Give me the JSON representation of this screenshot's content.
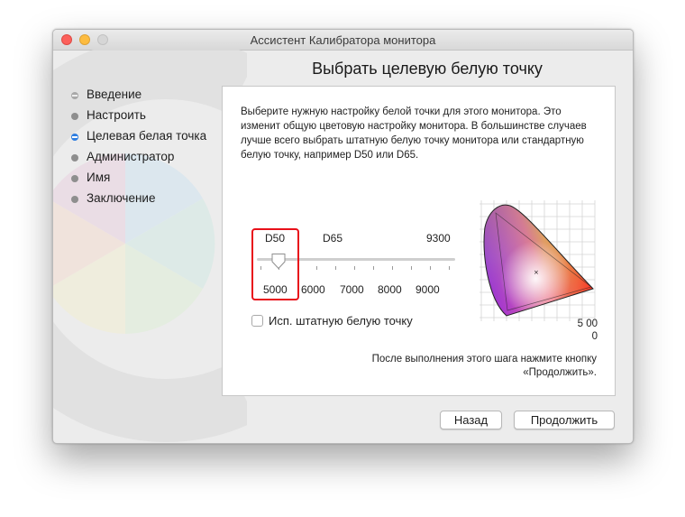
{
  "window": {
    "title": "Ассистент Калибратора монитора"
  },
  "page": {
    "title": "Выбрать целевую белую точку"
  },
  "steps": [
    {
      "label": "Введение",
      "state": "done"
    },
    {
      "label": "Настроить",
      "state": "pending"
    },
    {
      "label": "Целевая белая точка",
      "state": "active"
    },
    {
      "label": "Администратор",
      "state": "pending"
    },
    {
      "label": "Имя",
      "state": "pending"
    },
    {
      "label": "Заключение",
      "state": "pending"
    }
  ],
  "description": "Выберите нужную настройку белой точки для этого монитора. Это изменит общую цветовую настройку монитора. В большинстве случаев лучше всего выбрать штатную белую точку монитора или стандартную белую точку, например D50 или D65.",
  "slider": {
    "top_labels": [
      "D50",
      "D65",
      "9300"
    ],
    "bottom_labels": [
      "5000",
      "6000",
      "7000",
      "8000",
      "9000"
    ],
    "selected_label": "D50",
    "value_kelvin": 5000
  },
  "native_white_checkbox": {
    "label": "Исп. штатную белую точку",
    "checked": false
  },
  "gamut_value": [
    "5 00",
    "0"
  ],
  "footer_note": "После выполнения этого шага нажмите кнопку «Продолжить».",
  "buttons": {
    "back": "Назад",
    "continue": "Продолжить"
  },
  "colors": {
    "highlight": "#e8101a",
    "active_step": "#2f7ee0",
    "window_bg": "#ececec"
  }
}
